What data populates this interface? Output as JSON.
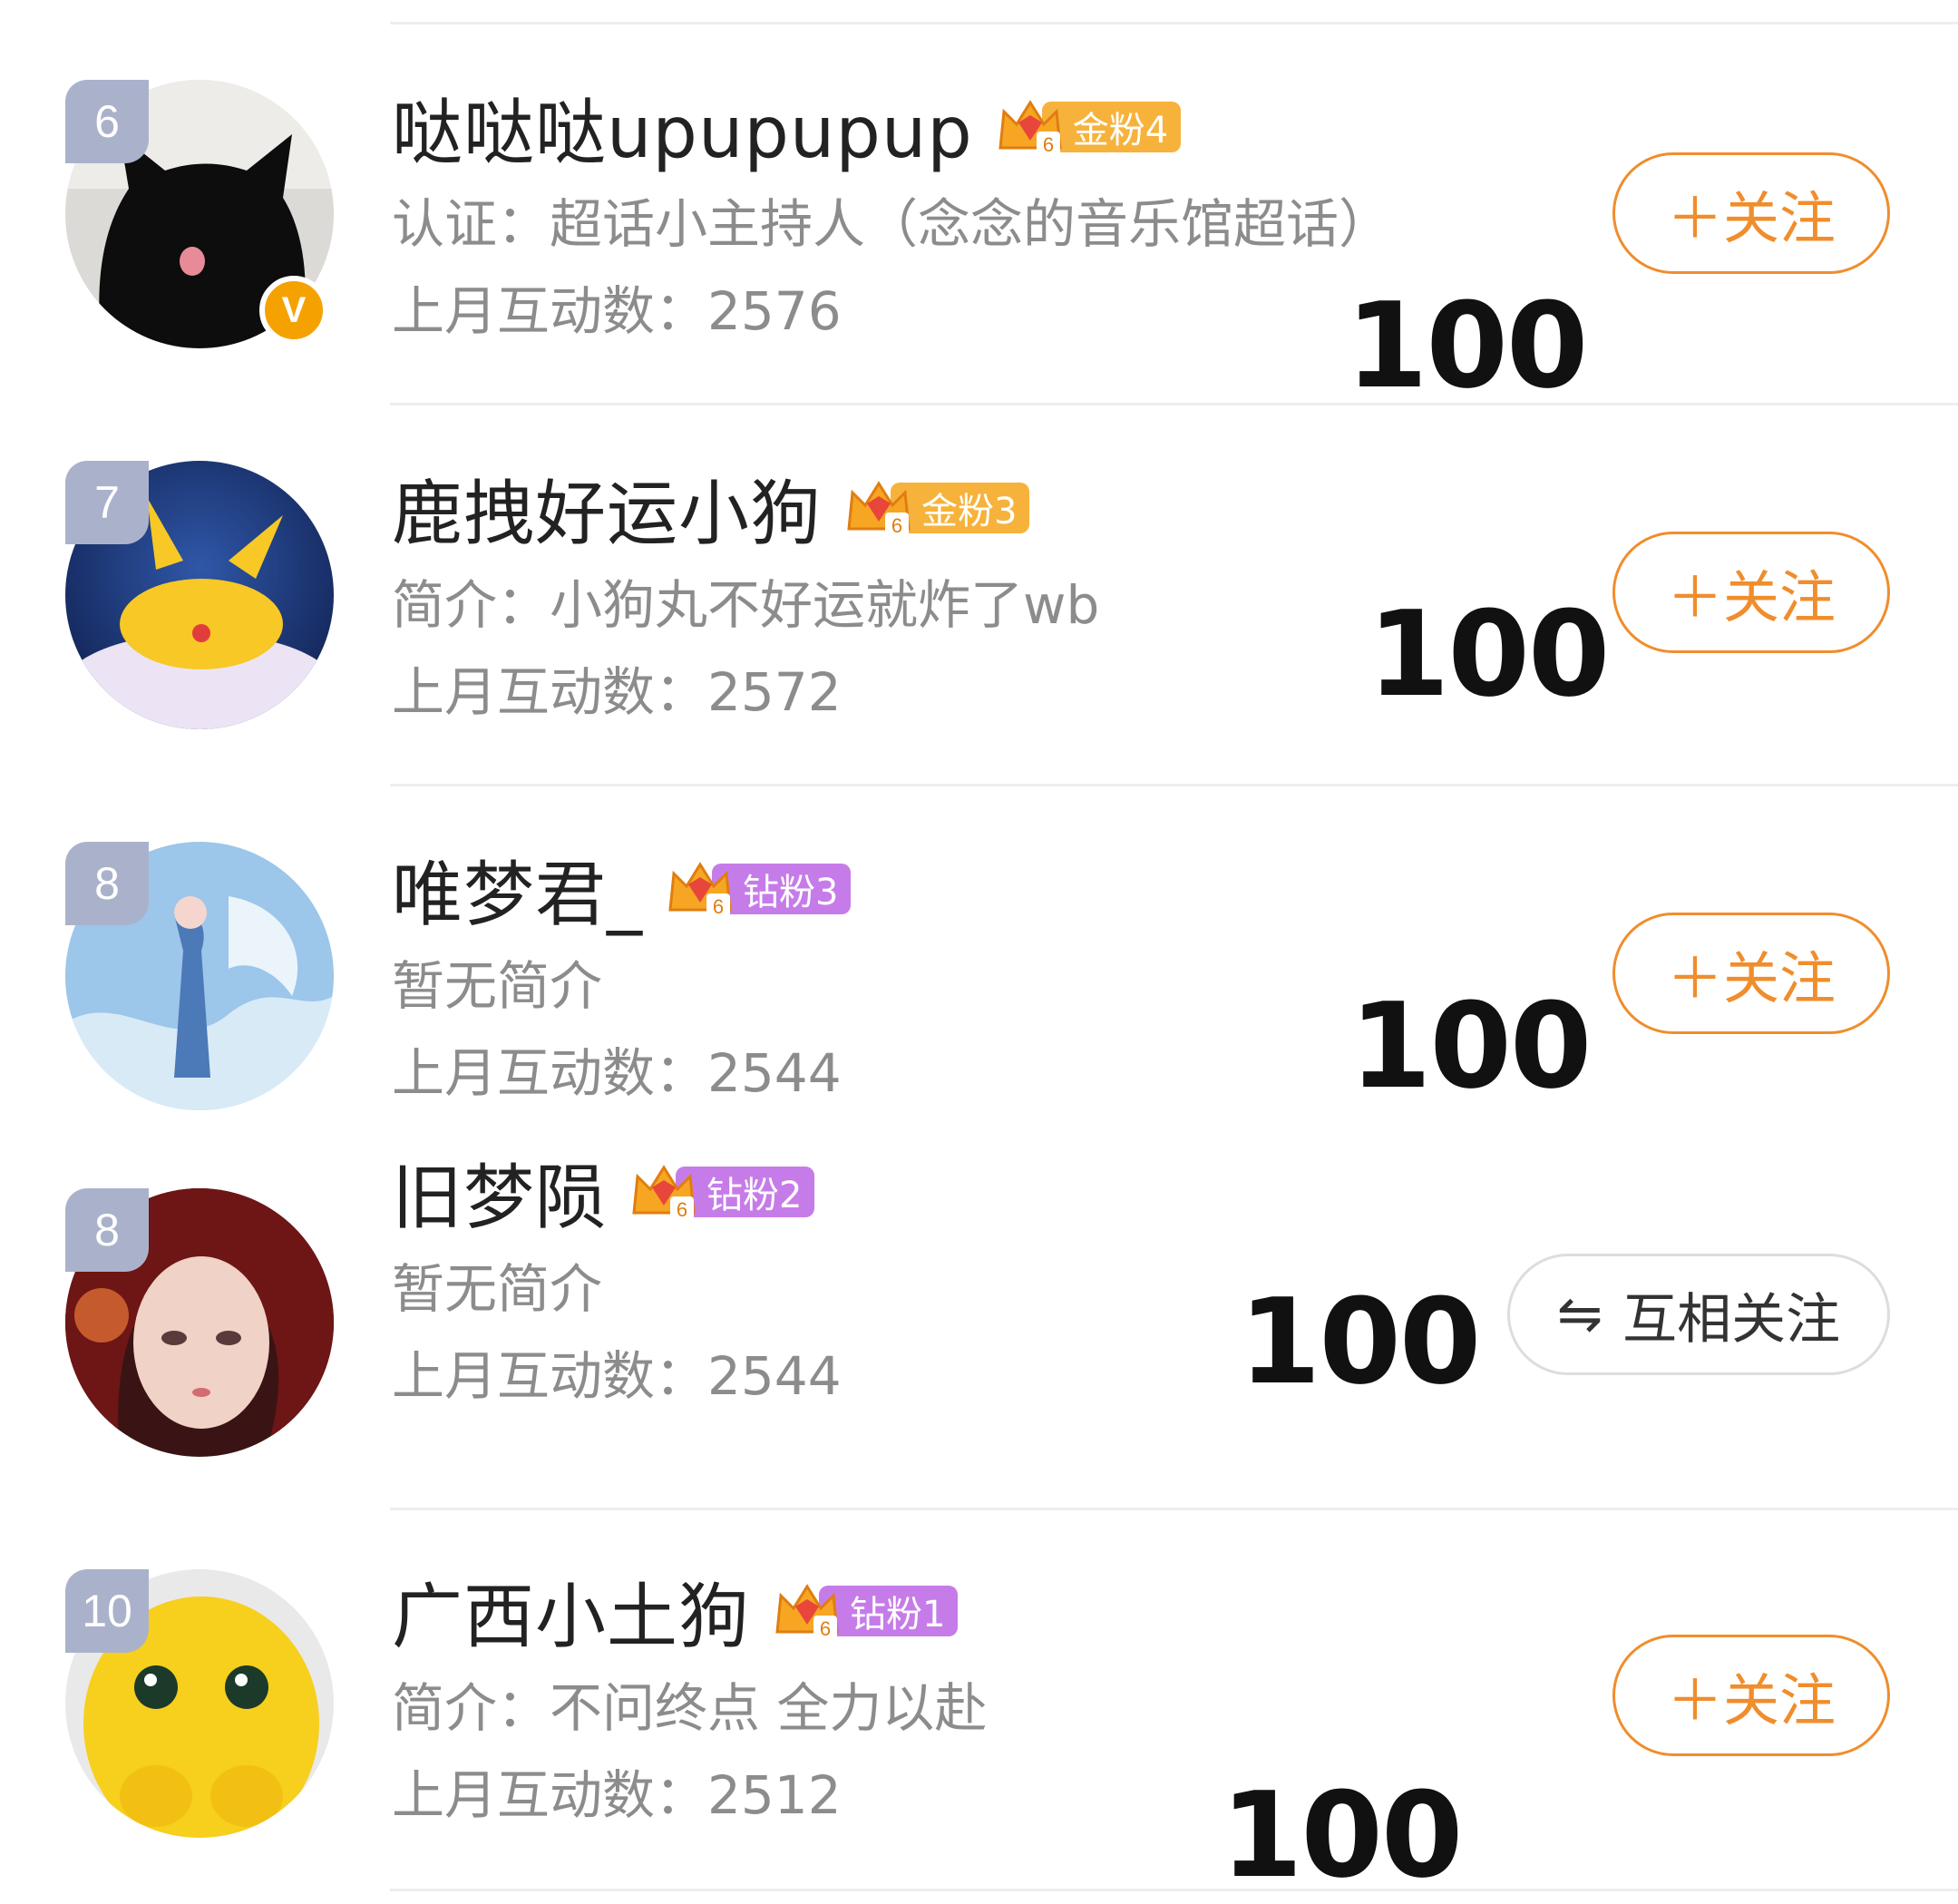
{
  "rows": [
    {
      "rank": "6",
      "name": "哒哒哒upupupup",
      "badge": "金粉4",
      "bio": "认证：超话小主持人（念念的音乐馆超话）",
      "stat": "上月互动数：2576",
      "score": "100",
      "action": "＋关注",
      "verified": true
    },
    {
      "rank": "7",
      "name": "鹿拽好运小狗",
      "badge": "金粉3",
      "bio": "简介：小狗丸不好运就炸了wb",
      "stat": "上月互动数：2572",
      "score": "100",
      "action": "＋关注"
    },
    {
      "rank": "8",
      "name": "唯梦君_",
      "badge": "钻粉3",
      "bio": "暂无简介",
      "stat": "上月互动数：2544",
      "score": "100",
      "action": "＋关注"
    },
    {
      "rank": "8",
      "name": "旧梦陨",
      "badge": "钻粉2",
      "bio": "暂无简介",
      "stat": "上月互动数：2544",
      "score": "100",
      "action": "互相关注",
      "action_icon": "⇋"
    },
    {
      "rank": "10",
      "name": "广西小土狗",
      "badge": "钻粉1",
      "bio": "简介：不问终点 全力以赴",
      "stat": "上月互动数：2512",
      "score": "100",
      "action": "＋关注"
    }
  ],
  "badge_level": "6",
  "verified_mark": "V",
  "colors": {
    "gold_pill": "#f6b23b",
    "diamond_pill": "#c67ce8",
    "follow_orange": "#f08d2c",
    "rank_grey": "#aab2cb",
    "verified_yellow": "#f5a200"
  }
}
